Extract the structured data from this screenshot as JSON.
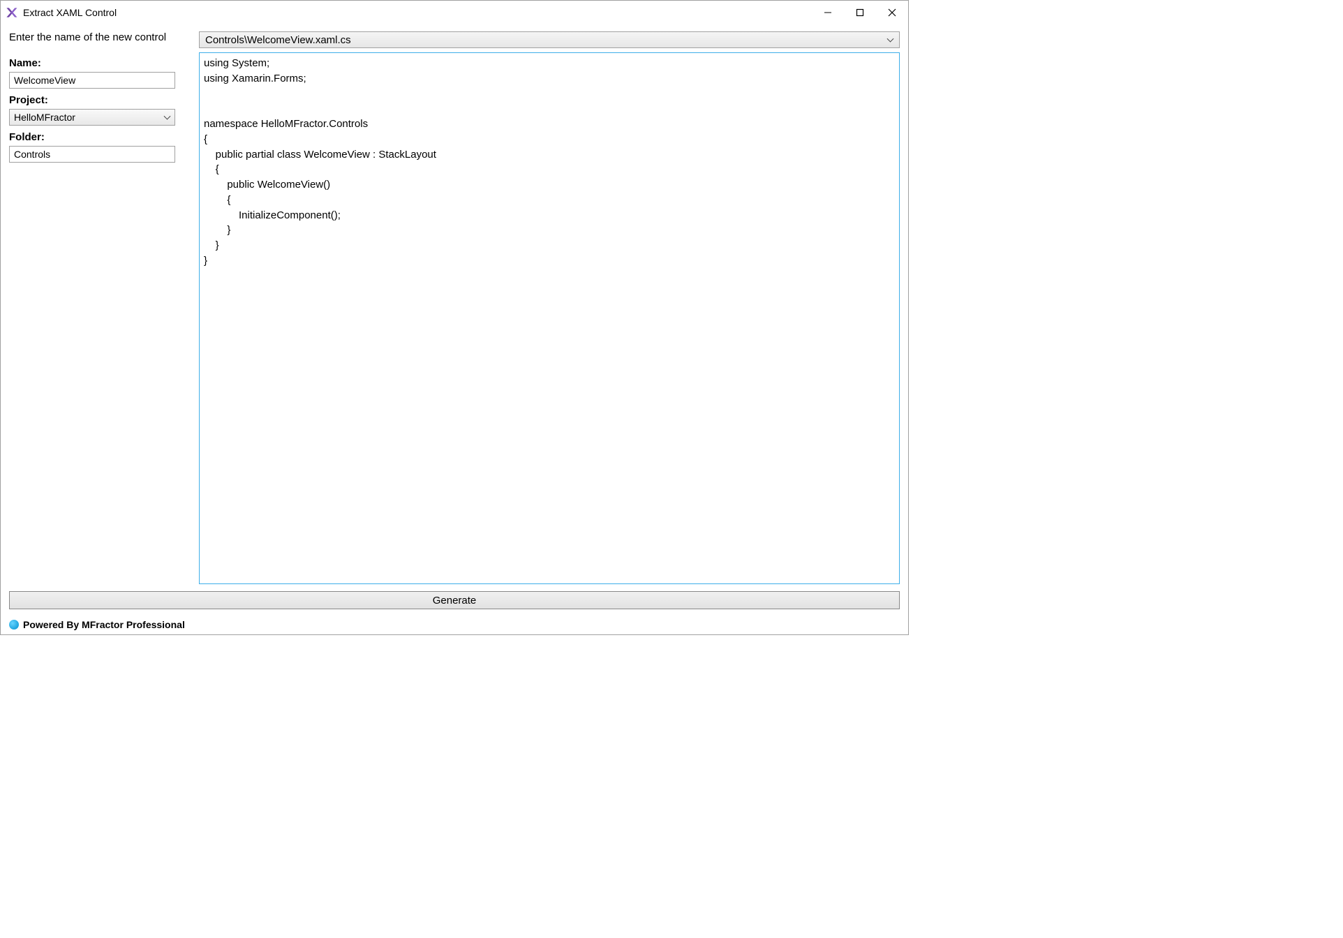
{
  "window": {
    "title": "Extract XAML Control"
  },
  "form": {
    "prompt": "Enter the name of the new control",
    "name_label": "Name:",
    "name_value": "WelcomeView",
    "project_label": "Project:",
    "project_value": "HelloMFractor",
    "folder_label": "Folder:",
    "folder_value": "Controls"
  },
  "preview": {
    "file_selected": "Controls\\WelcomeView.xaml.cs",
    "code": "using System;\nusing Xamarin.Forms;\n\n\nnamespace HelloMFractor.Controls\n{\n    public partial class WelcomeView : StackLayout\n    {\n        public WelcomeView()\n        {\n            InitializeComponent();\n        }\n    }\n}"
  },
  "actions": {
    "generate_label": "Generate"
  },
  "footer": {
    "text": "Powered By MFractor Professional"
  }
}
